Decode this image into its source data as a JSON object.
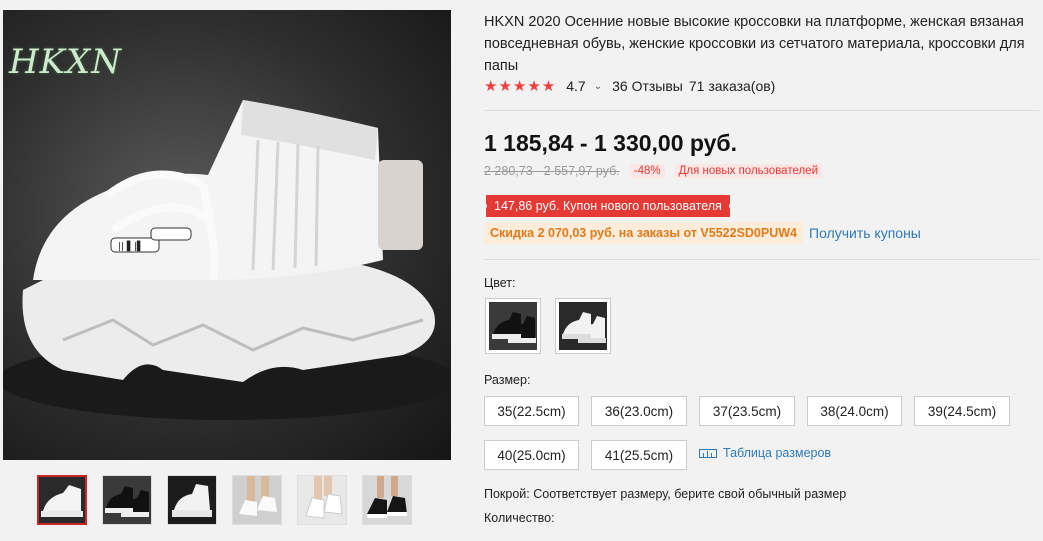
{
  "gallery": {
    "brand_watermark": "HKXN",
    "thumbnails": [
      {
        "name": "white-side",
        "bg": "#2a2a2a"
      },
      {
        "name": "black-pair",
        "bg": "#3a3a3a"
      },
      {
        "name": "white-angle",
        "bg": "#1c1c1c"
      },
      {
        "name": "worn-street",
        "bg": "#cfcfcf"
      },
      {
        "name": "worn-white",
        "bg": "#e8e8e8"
      },
      {
        "name": "worn-black",
        "bg": "#d8d8d8"
      }
    ]
  },
  "product": {
    "title": "HKXN 2020 Осенние новые высокие кроссовки на платформе, женская вязаная повседневная обувь, женские кроссовки из сетчатого материала, кроссовки для папы",
    "stars": "★★★★★",
    "rating": "4.7",
    "reviews": "36 Отзывы",
    "orders": "71 заказа(ов)"
  },
  "pricing": {
    "price": "1 185,84 - 1 330,00 руб.",
    "old_price": "2 280,73 - 2 557,97 руб.",
    "discount": "-48%",
    "new_users": "Для новых пользователей",
    "new_user_coupon": "147,86 руб. Купон нового пользователя",
    "store_coupon": "Скидка 2 070,03 руб. на заказы от V5522SD0PUW4",
    "get_coupons": "Получить купоны"
  },
  "options": {
    "color_label": "Цвет:",
    "colors": [
      "black",
      "white"
    ],
    "size_label": "Размер:",
    "sizes": [
      "35(22.5cm)",
      "36(23.0cm)",
      "37(23.5cm)",
      "38(24.0cm)",
      "39(24.5cm)",
      "40(25.0cm)",
      "41(25.5cm)"
    ],
    "size_table": "Таблица размеров",
    "fit": "Покрой: Соответствует размеру, берите свой обычный размер",
    "quantity_label": "Количество:"
  },
  "colors": {
    "accent_red": "#e53935",
    "link_blue": "#2e7bb8",
    "coupon_orange": "#e07b1b"
  }
}
